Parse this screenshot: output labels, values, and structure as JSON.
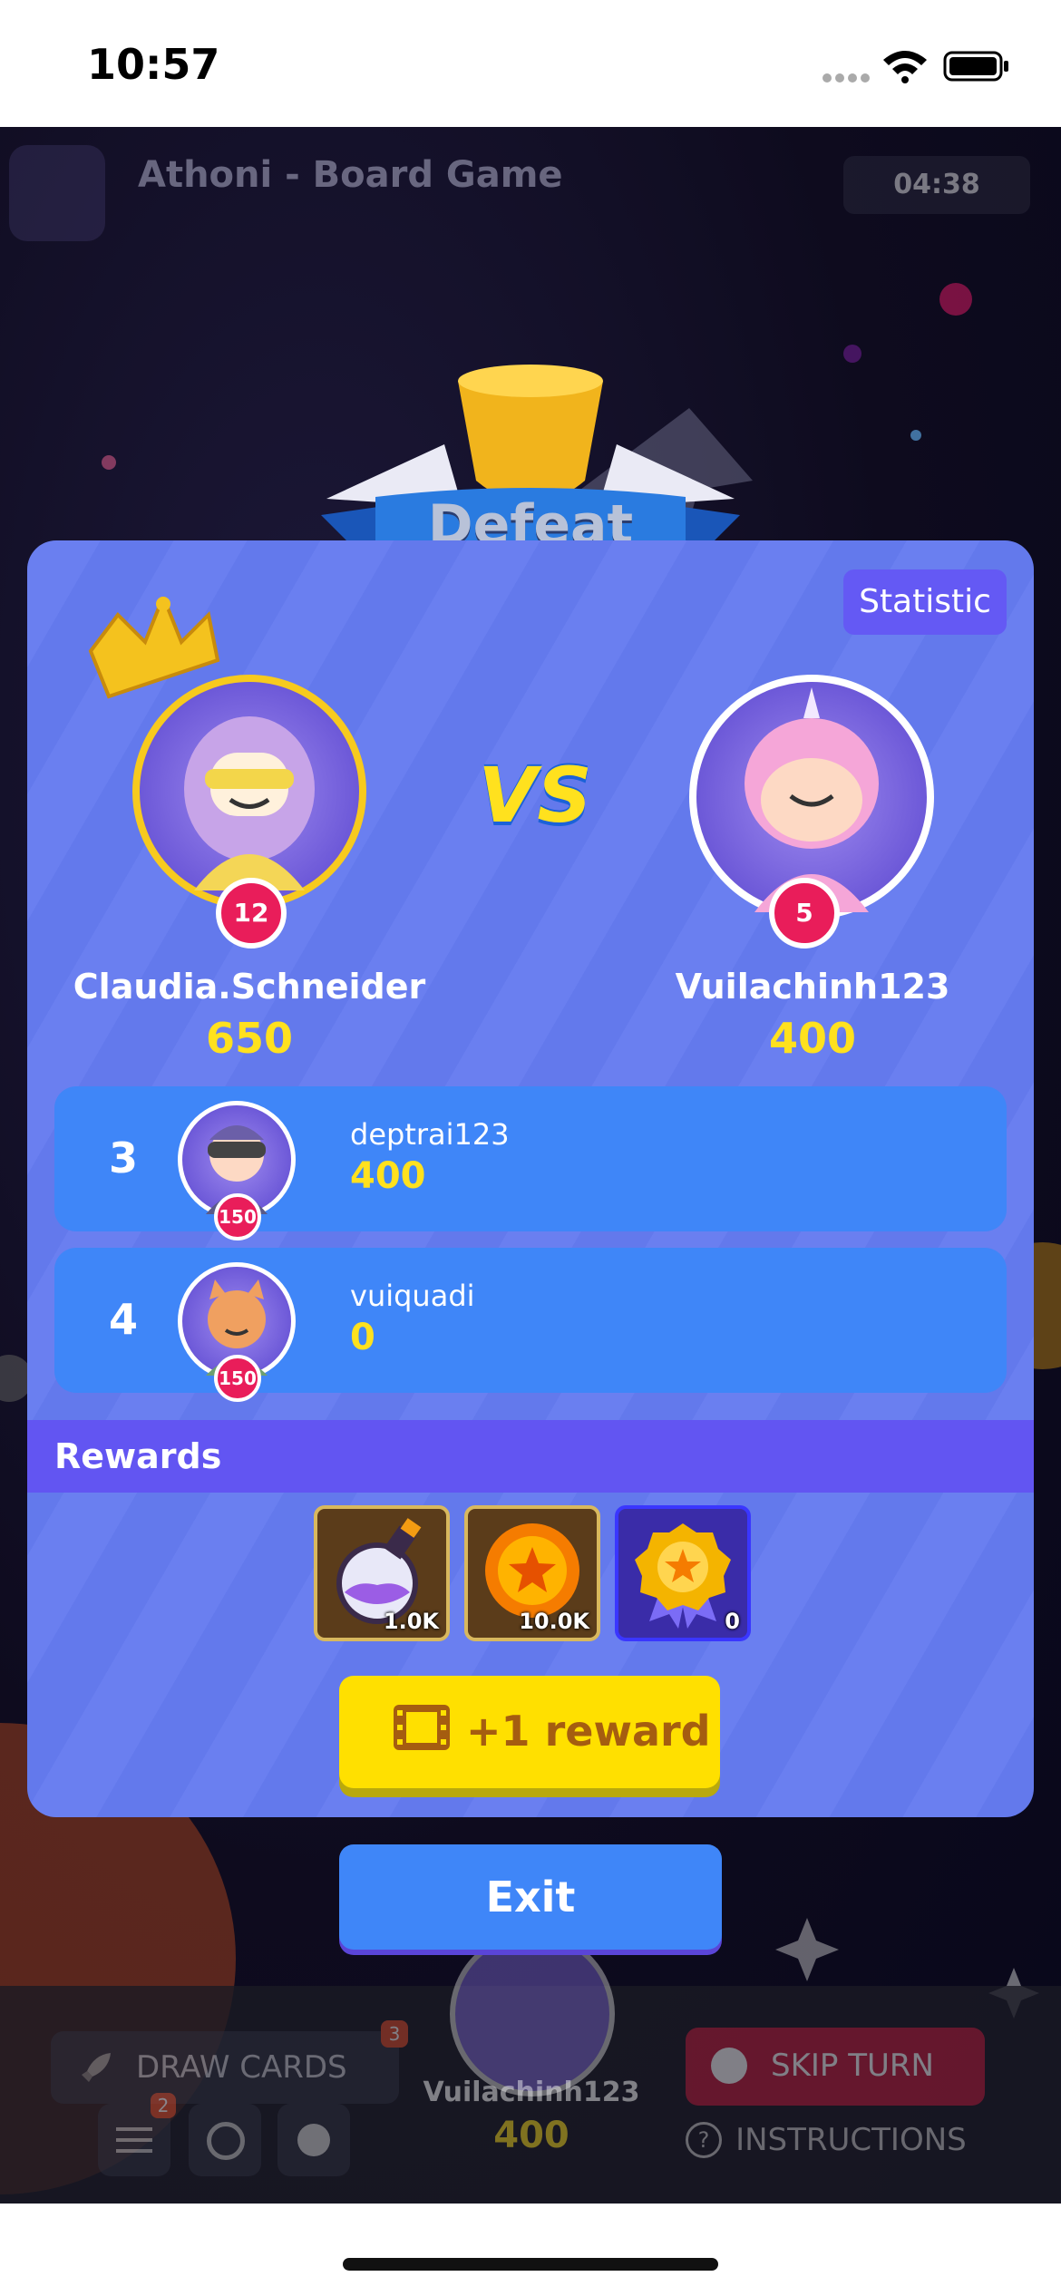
{
  "status_bar": {
    "time": "10:57"
  },
  "game_header": {
    "title": "Athoni - Board Game",
    "timer": "04:38"
  },
  "banner": {
    "result": "Defeat"
  },
  "panel": {
    "statistic_label": "Statistic",
    "vs_label": "VS",
    "player_left": {
      "name": "Claudia.Schneider",
      "score": "650",
      "level": "12"
    },
    "player_right": {
      "name": "Vuilachinh123",
      "score": "400",
      "level": "5"
    },
    "others": [
      {
        "rank": "3",
        "name": "deptrai123",
        "score": "400",
        "badge": "150"
      },
      {
        "rank": "4",
        "name": "vuiquadi",
        "score": "0",
        "badge": "150"
      }
    ],
    "rewards_label": "Rewards",
    "rewards": [
      {
        "icon": "potion-icon",
        "count": "1.0K"
      },
      {
        "icon": "coin-icon",
        "count": "10.0K"
      },
      {
        "icon": "medal-icon",
        "count": "0"
      }
    ],
    "reward_button": "+1 reward",
    "exit_button": "Exit"
  },
  "background_ui": {
    "draw_cards": "DRAW CARDS",
    "draw_cards_count": "3",
    "skip_turn": "SKIP TURN",
    "current_player": "Vuilachinh123",
    "current_score": "400",
    "instructions": "INSTRUCTIONS",
    "list_badge": "2"
  },
  "colors": {
    "panel": "#6a7ff0",
    "row": "#3f86f8",
    "accent_yellow": "#ffe11e",
    "badge_red": "#e91d5a",
    "rewards_bar": "#6255f2",
    "exit_button": "#3f86f8"
  }
}
